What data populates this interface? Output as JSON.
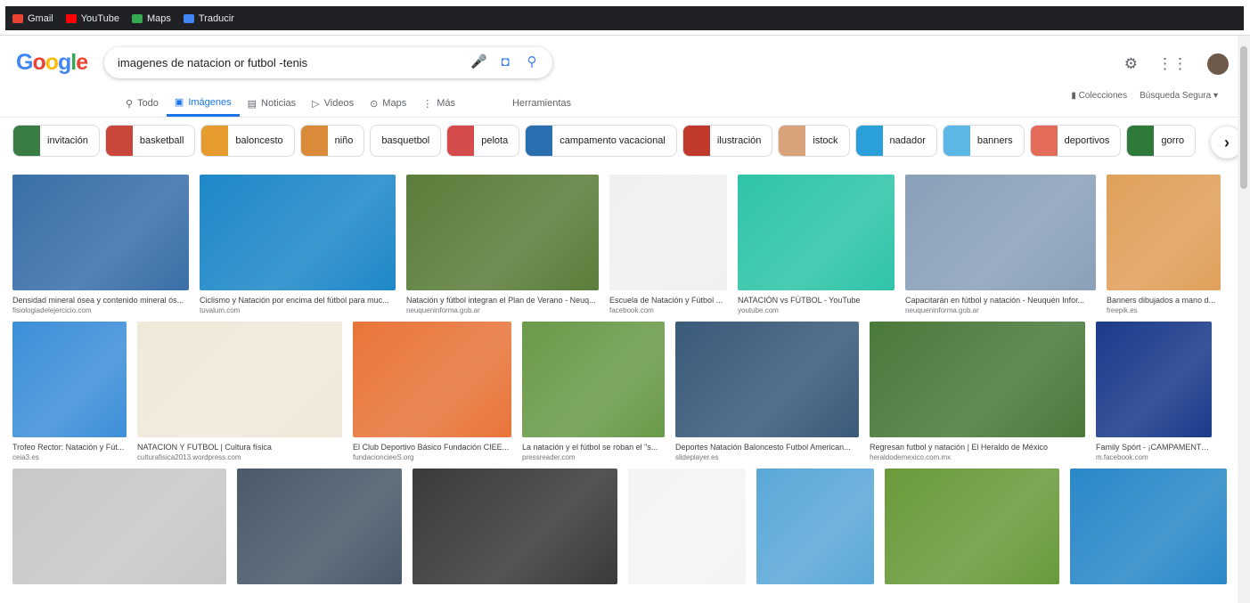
{
  "bookmarks": [
    {
      "label": "Gmail",
      "icon": "gmail-icon",
      "color": "#ea4335"
    },
    {
      "label": "YouTube",
      "icon": "youtube-icon",
      "color": "#ff0000"
    },
    {
      "label": "Maps",
      "icon": "maps-icon",
      "color": "#34a853"
    },
    {
      "label": "Traducir",
      "icon": "translate-icon",
      "color": "#4285f4"
    }
  ],
  "logo": "Google",
  "search": {
    "value": "imagenes de natacion or futbol -tenis"
  },
  "tabs": [
    {
      "label": "Todo",
      "icon": "search-icon"
    },
    {
      "label": "Imágenes",
      "icon": "image-icon",
      "active": true
    },
    {
      "label": "Noticias",
      "icon": "news-icon"
    },
    {
      "label": "Videos",
      "icon": "video-icon"
    },
    {
      "label": "Maps",
      "icon": "map-pin-icon"
    },
    {
      "label": "Más",
      "icon": "more-vert-icon"
    }
  ],
  "tools_label": "Herramientas",
  "collections_label": "Colecciones",
  "safesearch_label": "Búsqueda Segura",
  "chips": [
    {
      "label": "invitación",
      "color": "#3a7d44"
    },
    {
      "label": "basketball",
      "color": "#c8463a"
    },
    {
      "label": "baloncesto",
      "color": "#e59b2d"
    },
    {
      "label": "niño",
      "color": "#d98b3a"
    },
    {
      "label": "basquetbol",
      "color": ""
    },
    {
      "label": "pelota",
      "color": "#d64b4b"
    },
    {
      "label": "campamento vacacional",
      "color": "#2a6fb0"
    },
    {
      "label": "ilustración",
      "color": "#c0392b"
    },
    {
      "label": "istock",
      "color": "#d8a37a"
    },
    {
      "label": "nadador",
      "color": "#2b9fd8"
    },
    {
      "label": "banners",
      "color": "#5bb8e6"
    },
    {
      "label": "deportivos",
      "color": "#e36b5a"
    },
    {
      "label": "gorro",
      "color": "#2d7a3a"
    }
  ],
  "rows": [
    [
      {
        "w": 198,
        "title": "Densidad mineral ósea y contenido mineral ós...",
        "source": "fisiologiadelejercicio.com",
        "color": "#3a6fa8"
      },
      {
        "w": 220,
        "title": "Ciclismo y Natación por encima del fútbol para muc...",
        "source": "tuvalum.com",
        "color": "#1e88c8"
      },
      {
        "w": 216,
        "title": "Natación y fútbol integran el Plan de Verano - Neuq...",
        "source": "neuqueninforma.gob.ar",
        "color": "#5b7d3a"
      },
      {
        "w": 132,
        "title": "Escuela de Natación y Fútbol ...",
        "source": "facebook.com",
        "color": "#f0f0f0"
      },
      {
        "w": 176,
        "title": "NATACIÓN vs FÚTBOL - YouTube",
        "source": "youtube.com",
        "color": "#2ec4a8"
      },
      {
        "w": 214,
        "title": "Capacitarán en fútbol y natación - Neuquén Infor...",
        "source": "neuqueninforma.gob.ar",
        "color": "#8aa0b8"
      },
      {
        "w": 128,
        "title": "Banners dibujados a mano d...",
        "source": "freepik.es",
        "color": "#e0a05a"
      }
    ],
    [
      {
        "w": 128,
        "title": "Trofeo Rector: Natación y Fút...",
        "source": "ceia3.es",
        "color": "#3d8fd8"
      },
      {
        "w": 230,
        "title": "NATACION Y FUTBOL | Cultura física",
        "source": "culturafisica2013.wordpress.com",
        "color": "#efe9d9"
      },
      {
        "w": 178,
        "title": "El Club Deportivo Básico Fundación CIEE...",
        "source": "fundacioncieeS.org",
        "color": "#e8753a"
      },
      {
        "w": 160,
        "title": "La natación y el fútbol se roban el \"s...",
        "source": "pressreader.com",
        "color": "#6a9a4a"
      },
      {
        "w": 206,
        "title": "Deportes Natación Baloncesto Futbol American...",
        "source": "slideplayer.es",
        "color": "#3a5a7a"
      },
      {
        "w": 242,
        "title": "Regresan futbol y natación | El Heraldo de México",
        "source": "heraldodemexico.com.mx",
        "color": "#4a7a3a"
      },
      {
        "w": 130,
        "title": "Family Spórt - ¡CAMPAMENTO VA...",
        "source": "m.facebook.com",
        "color": "#1a3a8a"
      }
    ],
    [
      {
        "w": 240,
        "title": "",
        "source": "",
        "color": "#c8c8c8"
      },
      {
        "w": 185,
        "title": "",
        "source": "",
        "color": "#4a5a6a"
      },
      {
        "w": 230,
        "title": "",
        "source": "",
        "color": "#3a3a3a"
      },
      {
        "w": 132,
        "title": "",
        "source": "",
        "color": "#f4f4f4"
      },
      {
        "w": 132,
        "title": "",
        "source": "",
        "color": "#5aa8d8"
      },
      {
        "w": 196,
        "title": "",
        "source": "",
        "color": "#6a9a3a"
      },
      {
        "w": 176,
        "title": "",
        "source": "",
        "color": "#2a88c8"
      }
    ]
  ]
}
